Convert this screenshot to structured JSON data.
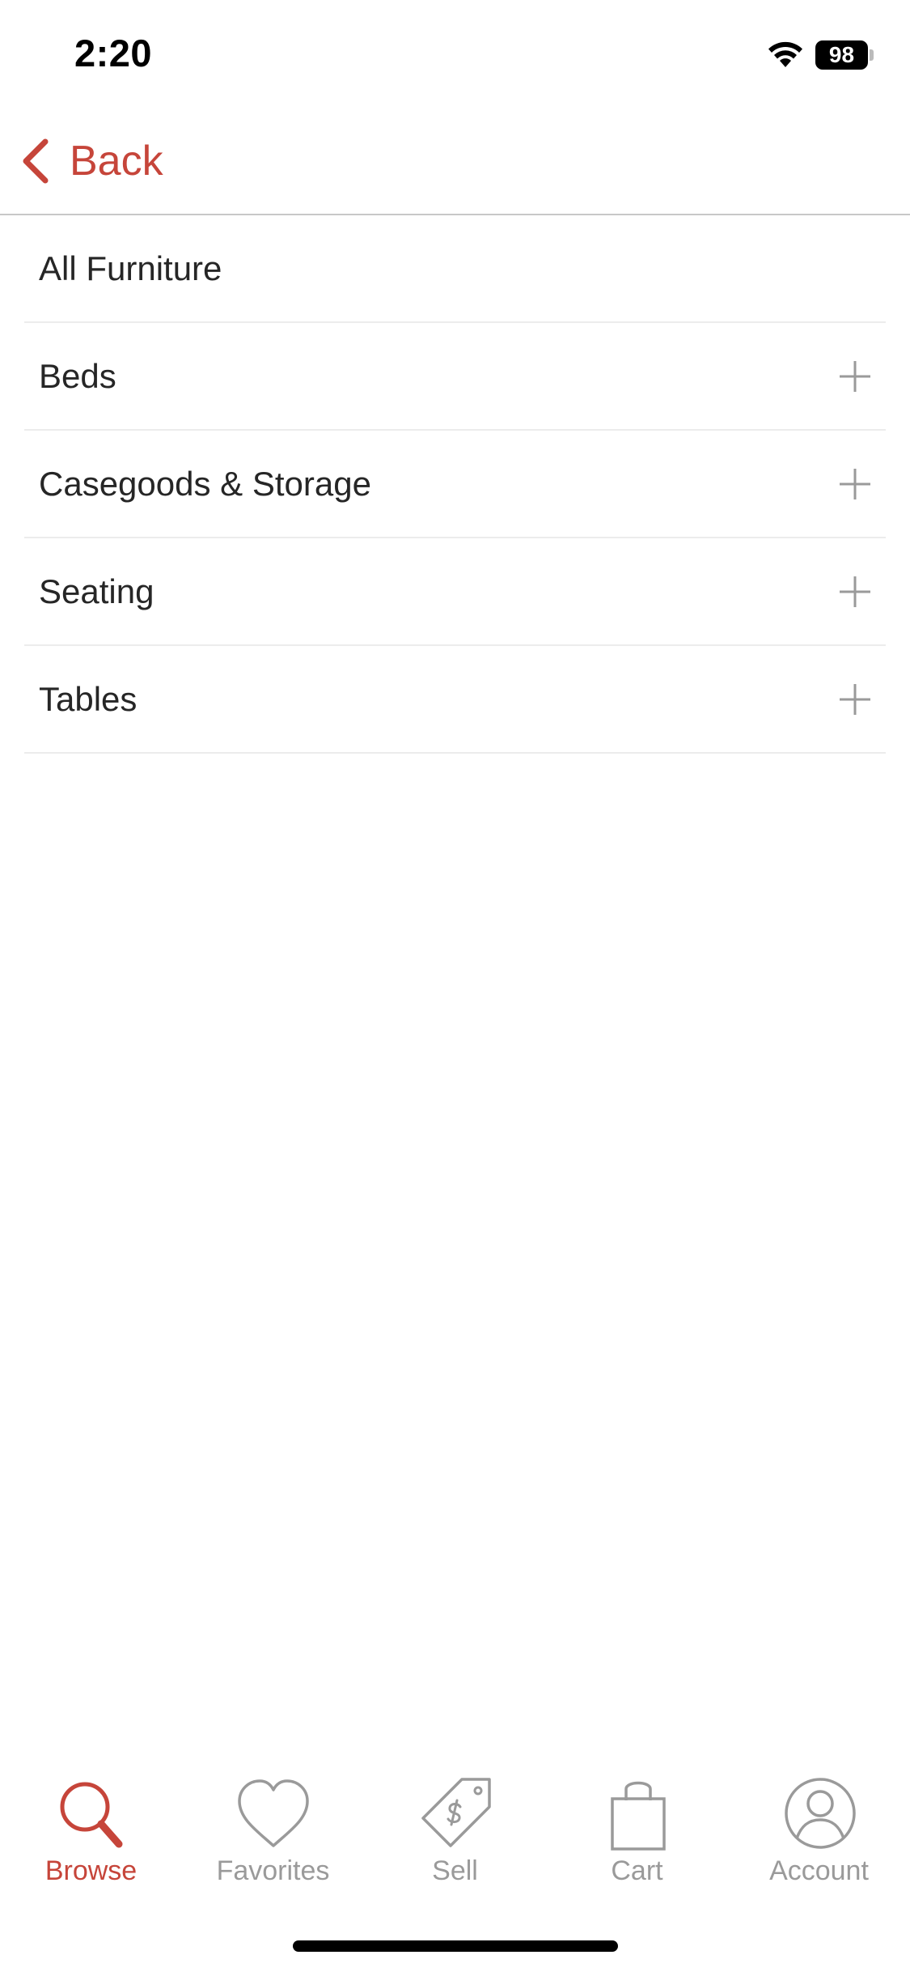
{
  "status_bar": {
    "time": "2:20",
    "battery_level": "98",
    "wifi_icon": "wifi-icon",
    "battery_icon": "battery-icon"
  },
  "nav": {
    "back_label": "Back",
    "back_icon": "chevron-left-icon"
  },
  "categories": [
    {
      "label": "All Furniture",
      "expandable": false
    },
    {
      "label": "Beds",
      "expandable": true
    },
    {
      "label": "Casegoods & Storage",
      "expandable": true
    },
    {
      "label": "Seating",
      "expandable": true
    },
    {
      "label": "Tables",
      "expandable": true
    }
  ],
  "tabs": [
    {
      "label": "Browse",
      "icon": "search-icon",
      "active": true
    },
    {
      "label": "Favorites",
      "icon": "heart-icon",
      "active": false
    },
    {
      "label": "Sell",
      "icon": "price-tag-icon",
      "active": false
    },
    {
      "label": "Cart",
      "icon": "shopping-bag-icon",
      "active": false
    },
    {
      "label": "Account",
      "icon": "account-icon",
      "active": false
    }
  ],
  "colors": {
    "accent": "#c6453a",
    "inactive": "#9a9a9a",
    "divider": "#ececec"
  }
}
